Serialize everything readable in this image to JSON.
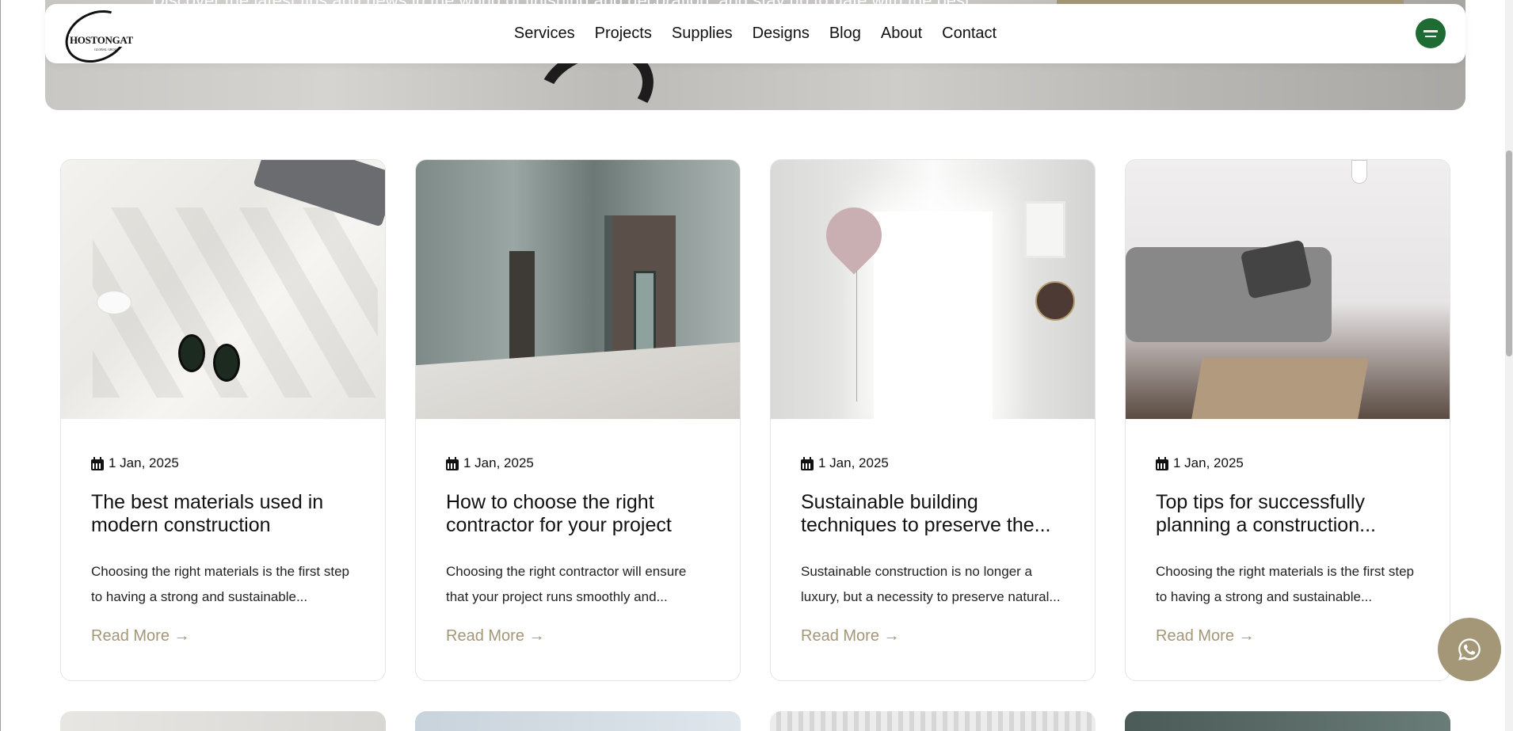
{
  "hero": {
    "subtitle": "Discover the latest tips and news in the world of finishing and decoration, and stay up to date with the best"
  },
  "header": {
    "logo_text": "HOSTONGAT",
    "logo_sub": "GLOBAL GROUP",
    "nav": [
      "Services",
      "Projects",
      "Supplies",
      "Designs",
      "Blog",
      "About",
      "Contact"
    ],
    "language_icon": "saudi-flag-icon"
  },
  "posts": [
    {
      "date": "1 Jan, 2025",
      "title": "The best materials used in modern construction",
      "excerpt": "Choosing the right materials is the first step to having a strong and sustainable...",
      "read_more": "Read More →"
    },
    {
      "date": "1 Jan, 2025",
      "title": "How to choose the right contractor for your project",
      "excerpt": "Choosing the right contractor will ensure that your project runs smoothly and...",
      "read_more": "Read More →"
    },
    {
      "date": "1 Jan, 2025",
      "title": "Sustainable building techniques to preserve the...",
      "excerpt": "Sustainable construction is no longer a luxury, but a necessity to preserve natural...",
      "read_more": "Read More →"
    },
    {
      "date": "1 Jan, 2025",
      "title": "Top tips for successfully planning a construction...",
      "excerpt": "Choosing the right materials is the first step to having a strong and sustainable...",
      "read_more": "Read More →"
    }
  ],
  "floating": {
    "whatsapp_icon": "whatsapp-icon"
  },
  "colors": {
    "accent": "#a39777",
    "flag_green": "#1e6b33"
  }
}
